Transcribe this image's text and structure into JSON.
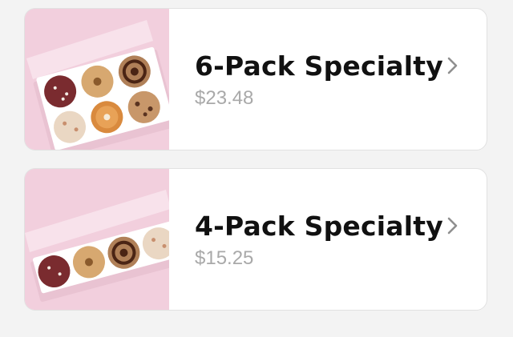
{
  "products": [
    {
      "name": "6-Pack Specialty",
      "price": "$23.48",
      "image_icon": "cookie-box-6-icon",
      "action_icon": "chevron-right-icon"
    },
    {
      "name": "4-Pack Specialty",
      "price": "$15.25",
      "image_icon": "cookie-box-4-icon",
      "action_icon": "chevron-right-icon"
    }
  ],
  "colors": {
    "background": "#f3f3f3",
    "card": "#ffffff",
    "thumb_bg": "#f2cfdd",
    "title": "#111111",
    "price": "#a9a9a9",
    "chevron": "#8f8f8f"
  }
}
